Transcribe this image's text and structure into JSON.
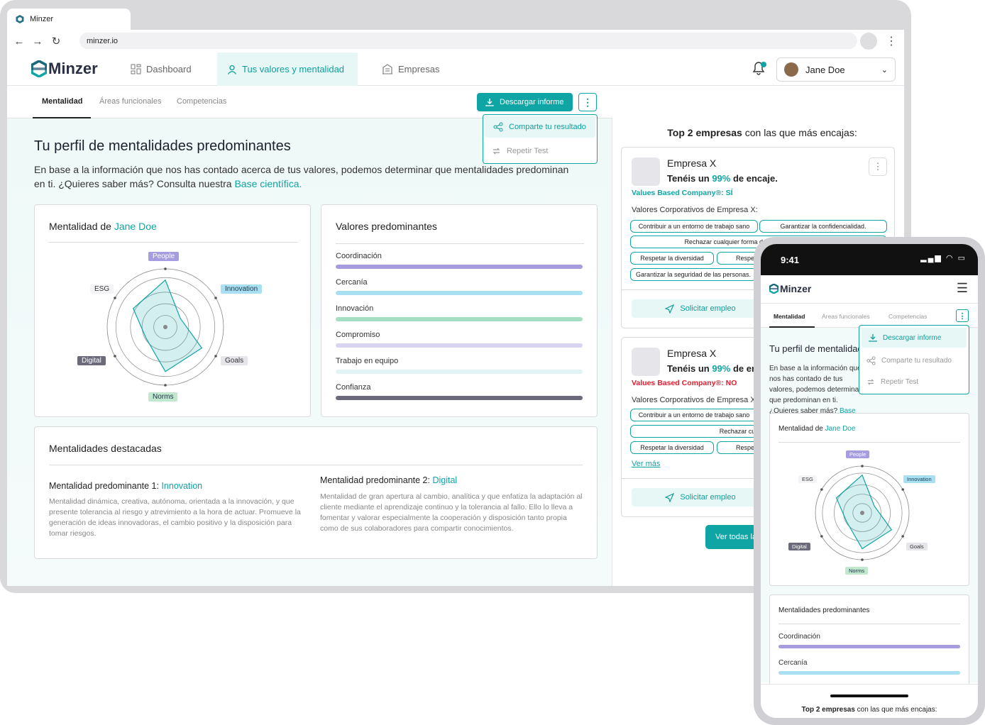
{
  "browser": {
    "tab_title": "Minzer",
    "url": "minzer.io"
  },
  "header": {
    "logo": "Minzer",
    "nav": [
      "Dashboard",
      "Tus valores y mentalidad",
      "Empresas"
    ],
    "user": "Jane Doe"
  },
  "subtabs": [
    "Mentalidad",
    "Áreas funcionales",
    "Competencias"
  ],
  "actions": {
    "download": "Descargar informe",
    "share": "Comparte tu resultado",
    "repeat": "Repetir Test"
  },
  "profile": {
    "title": "Tu perfil de mentalidades predominantes",
    "desc_prefix": "En base a la información que nos has contado acerca de tus valores, podemos determinar que mentalidades predominan en ti. ¿Quieres saber más? Consulta nuestra ",
    "desc_link": "Base científica."
  },
  "radar": {
    "title_prefix": "Mentalidad de ",
    "name": "Jane Doe",
    "axes": [
      "People",
      "Innovation",
      "Goals",
      "Norms",
      "Digital",
      "ESG"
    ],
    "values": [
      0.95,
      0.35,
      0.85,
      0.9,
      0.45,
      0.75
    ]
  },
  "values_card": {
    "title": "Valores predominantes",
    "items": [
      {
        "label": "Coordinación",
        "color": "#a59de0"
      },
      {
        "label": "Cercanía",
        "color": "#a8dff2"
      },
      {
        "label": "Innovación",
        "color": "#a4dfc4"
      },
      {
        "label": "Compromiso",
        "color": "#d9d4f2"
      },
      {
        "label": "Trabajo en equipo",
        "color": "#e0f4f6"
      },
      {
        "label": "Confianza",
        "color": "#6a6a7a"
      }
    ]
  },
  "featured": {
    "title": "Mentalidades destacadas",
    "m1_prefix": "Mentalidad predominante 1: ",
    "m1_name": "Innovation",
    "m1_desc": "Mentalidad dinámica, creativa, autónoma, orientada a la innovación, y que presente tolerancia al riesgo y atrevimiento a la hora de actuar. Promueve la generación de ideas innovadoras, el cambio positivo y la disposición para tomar riesgos.",
    "m2_prefix": "Mentalidad predominante 2: ",
    "m2_name": "Digital",
    "m2_desc": "Mentalidad de gran apertura al cambio, analítica y que enfatiza la adaptación al cliente mediante el aprendizaje continuo y la tolerancia al fallo. Ello lo lleva a fomentar y valorar especialmente la cooperación y disposición tanto propia como de sus colaboradores para compartir conocimientos."
  },
  "companies": {
    "title_bold": "Top 2 empresas",
    "title_rest": " con las que más encajas:",
    "c1": {
      "name": "Empresa X",
      "match_prefix": "Tenéis un ",
      "match_pct": "99%",
      "match_suffix": " de encaje.",
      "based": "Values Based Company®: SÍ",
      "values_title": "Valores Corporativos de Empresa X:",
      "chips": [
        "Contribuir a un entorno de trabajo sano",
        "Garantizar la confidencialidad.",
        "Rechazar cualquier forma de acoso o discriminación",
        "Respetar la diversidad",
        "Respetar la",
        "Garantizar la seguridad de las personas."
      ]
    },
    "c2": {
      "name": "Empresa X",
      "match_prefix": "Tenéis un ",
      "match_pct": "99%",
      "match_suffix": " de enca",
      "based": "Values Based Company®: NO",
      "values_title": "Valores Corporativos de Empresa X:",
      "chips": [
        "Contribuir a un entorno de trabajo sano",
        "Rechazar cualquier forma d",
        "Respetar la diversidad",
        "Respetar la"
      ]
    },
    "apply": "Solicitar empleo",
    "more": "Ver más",
    "all": "Ver todas las"
  },
  "phone": {
    "time": "9:41",
    "title": "Tu perfil de mentalidades",
    "desc_prefix": "En base a la información que nos has contado de tus valores, podemos determinar que predominan en ti. ¿Quieres saber más? ",
    "desc_link": "Base científica.",
    "values_title": "Mentalidades predominantes",
    "values": [
      "Coordinación",
      "Cercanía"
    ],
    "top2_bold": "Top 2 empresas",
    "top2_rest": " con las que más encajas:"
  }
}
